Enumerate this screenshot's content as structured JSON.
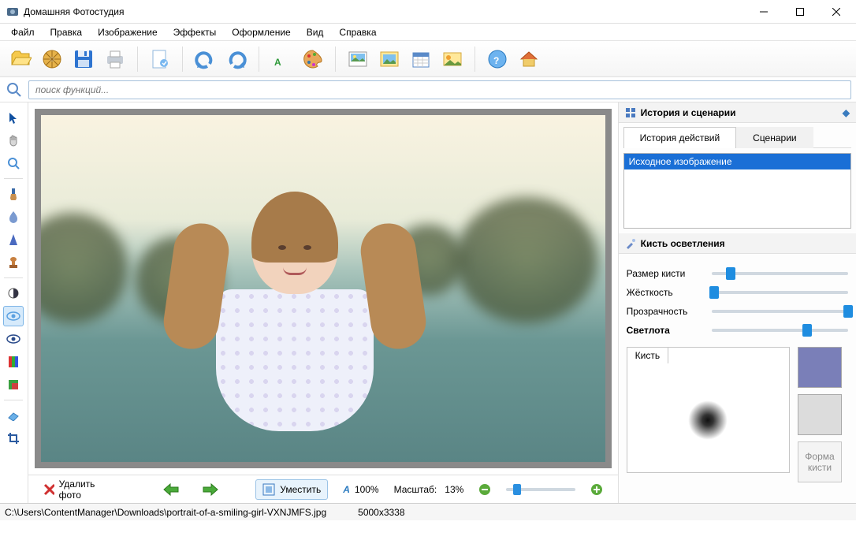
{
  "app": {
    "title": "Домашняя Фотостудия"
  },
  "menu": [
    "Файл",
    "Правка",
    "Изображение",
    "Эффекты",
    "Оформление",
    "Вид",
    "Справка"
  ],
  "search": {
    "placeholder": "поиск функций..."
  },
  "bottom": {
    "delete": "Удалить фото",
    "fit": "Уместить",
    "hundred": "100%",
    "scale_label": "Масштаб:",
    "scale_value": "13%"
  },
  "side": {
    "history_header": "История и сценарии",
    "tab_history": "История действий",
    "tab_scenarios": "Сценарии",
    "history_item": "Исходное изображение",
    "brush_header": "Кисть осветления",
    "size": "Размер кисти",
    "hardness": "Жёсткость",
    "opacity": "Прозрачность",
    "lightness": "Светлота",
    "brush_tab": "Кисть",
    "form_btn": "Форма кисти",
    "sliders": {
      "size": 14,
      "hardness": 2,
      "opacity": 100,
      "lightness": 70
    }
  },
  "status": {
    "path": "C:\\Users\\ContentManager\\Downloads\\portrait-of-a-smiling-girl-VXNJMFS.jpg",
    "dimensions": "5000x3338"
  }
}
